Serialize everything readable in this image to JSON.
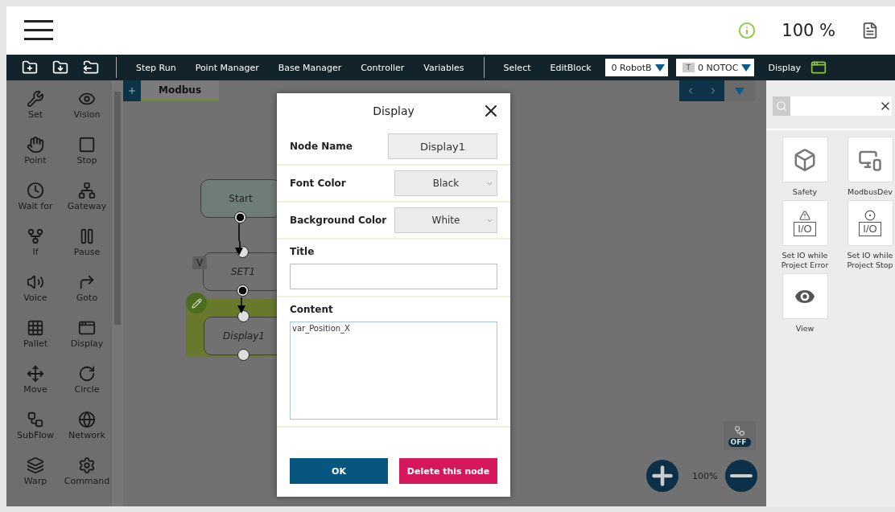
{
  "top_bar": {
    "zoom": "100 %"
  },
  "toolbar": {
    "commands": [
      "Step Run",
      "Point Manager",
      "Base Manager",
      "Controller",
      "Variables"
    ],
    "edit_commands": [
      "Select",
      "EditBlock"
    ],
    "base_dropdown": {
      "value": "0 RobotB"
    },
    "tool_dropdown": {
      "badge": "T",
      "value": "0 NOTOC"
    },
    "display_label": "Display"
  },
  "palette": {
    "items": [
      "Set",
      "Vision",
      "Point",
      "Stop",
      "Wait for",
      "Gateway",
      "If",
      "Pause",
      "Voice",
      "Goto",
      "Pallet",
      "Display",
      "Move",
      "Circle",
      "SubFlow",
      "Network",
      "Warp",
      "Command"
    ]
  },
  "canvas": {
    "tabs": [
      {
        "label": "Modbus",
        "selected": true
      }
    ],
    "nodes": [
      {
        "kind": "start",
        "label": "Start",
        "selected": false
      },
      {
        "kind": "set",
        "label": "SET1",
        "badge": "V",
        "selected": false
      },
      {
        "kind": "display",
        "label": "Display1",
        "selected": true
      }
    ],
    "zoom": "100%",
    "snap_toggle": {
      "label": "OFF",
      "on": false
    }
  },
  "dialog": {
    "title": "Display",
    "fields": [
      {
        "kind": "readonly",
        "label": "Node Name",
        "value": "Display1"
      },
      {
        "kind": "select",
        "label": "Font Color",
        "value": "Black"
      },
      {
        "kind": "select",
        "label": "Background Color",
        "value": "White"
      },
      {
        "kind": "input",
        "label": "Title"
      },
      {
        "kind": "textarea",
        "label": "Content",
        "value": "var_Position_X"
      }
    ],
    "ok": "OK",
    "delete": "Delete this node"
  },
  "library": {
    "items": [
      {
        "kind": "safety",
        "label": "Safety"
      },
      {
        "kind": "modbus",
        "label": "ModbusDev"
      },
      {
        "kind": "io_error",
        "label": "Set IO while Project Error",
        "icon_text": "I/O"
      },
      {
        "kind": "io_stop",
        "label": "Set IO while Project Stop",
        "icon_text": "I/O"
      },
      {
        "kind": "view",
        "label": "View"
      }
    ]
  }
}
